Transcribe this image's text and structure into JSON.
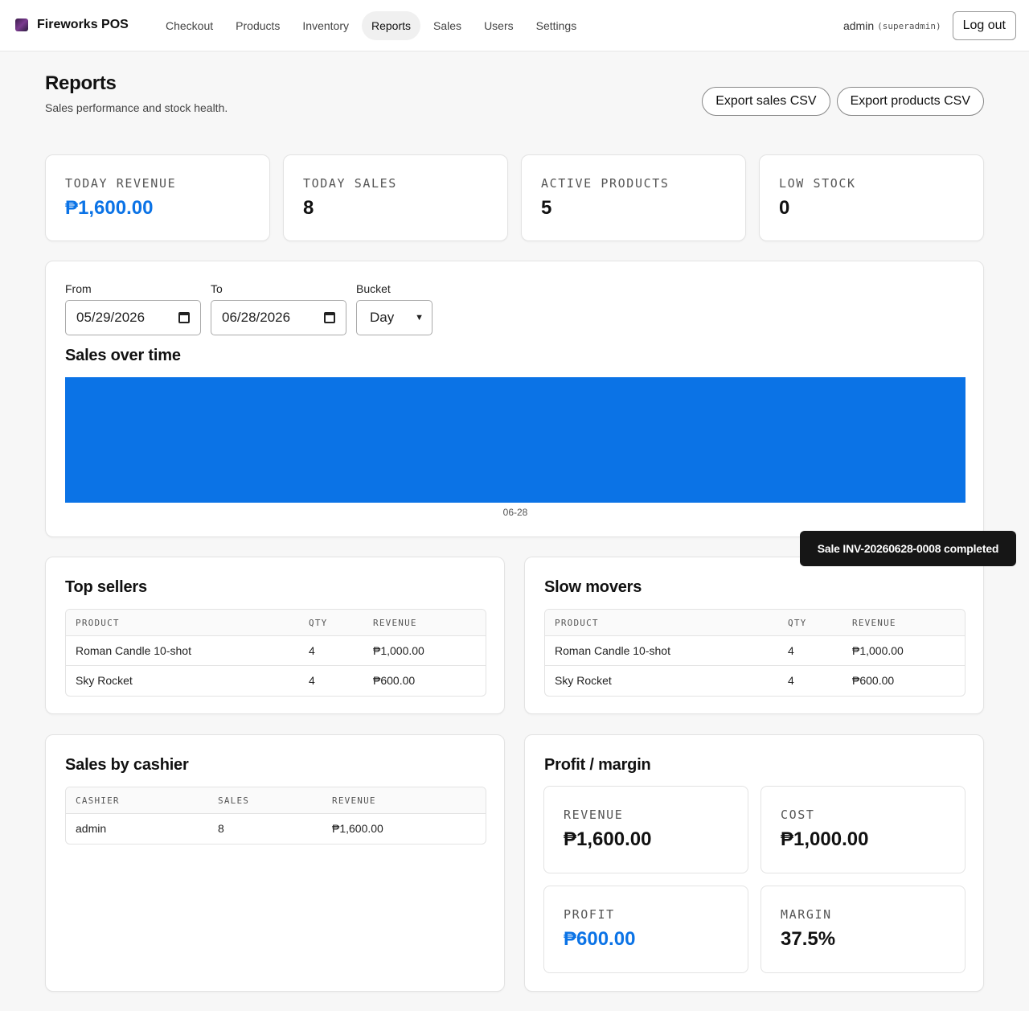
{
  "app": {
    "name": "Fireworks POS"
  },
  "nav": [
    {
      "label": "Checkout",
      "active": false
    },
    {
      "label": "Products",
      "active": false
    },
    {
      "label": "Inventory",
      "active": false
    },
    {
      "label": "Reports",
      "active": true
    },
    {
      "label": "Sales",
      "active": false
    },
    {
      "label": "Users",
      "active": false
    },
    {
      "label": "Settings",
      "active": false
    }
  ],
  "user": {
    "name": "admin",
    "role": "(superadmin)",
    "logout_label": "Log out"
  },
  "header": {
    "title": "Reports",
    "subtitle": "Sales performance and stock health."
  },
  "exports": {
    "sales": "Export sales CSV",
    "products": "Export products CSV"
  },
  "stats": [
    {
      "label": "Today revenue",
      "value": "₱1,600.00",
      "color": "#0b73e6"
    },
    {
      "label": "Today sales",
      "value": "8"
    },
    {
      "label": "Active products",
      "value": "5"
    },
    {
      "label": "Low stock",
      "value": "0"
    }
  ],
  "filters": {
    "from_label": "From",
    "from_value": "05/29/2026",
    "to_label": "To",
    "to_value": "06/28/2026",
    "bucket_label": "Bucket",
    "bucket_value": "Day"
  },
  "chart_title": "Sales over time",
  "chart_data": {
    "type": "bar",
    "categories": [
      "06-28"
    ],
    "values": [
      1600
    ],
    "color": "#0b73e6",
    "grid": false
  },
  "top_sellers": {
    "title": "Top sellers",
    "columns": [
      "PRODUCT",
      "QTY",
      "REVENUE"
    ],
    "rows": [
      [
        "Roman Candle 10-shot",
        "4",
        "₱1,000.00"
      ],
      [
        "Sky Rocket",
        "4",
        "₱600.00"
      ]
    ]
  },
  "slow_movers": {
    "title": "Slow movers",
    "columns": [
      "PRODUCT",
      "QTY",
      "REVENUE"
    ],
    "rows": [
      [
        "Roman Candle 10-shot",
        "4",
        "₱1,000.00"
      ],
      [
        "Sky Rocket",
        "4",
        "₱600.00"
      ]
    ]
  },
  "cashiers": {
    "title": "Sales by cashier",
    "columns": [
      "CASHIER",
      "SALES",
      "REVENUE"
    ],
    "rows": [
      [
        "admin",
        "8",
        "₱1,600.00"
      ]
    ]
  },
  "profit": {
    "title": "Profit / margin",
    "revenue_label": "Revenue",
    "revenue_value": "₱1,600.00",
    "cost_label": "Cost",
    "cost_value": "₱1,000.00",
    "profit_label": "Profit",
    "profit_value": "₱600.00",
    "margin_label": "Margin",
    "margin_value": "37.5%"
  },
  "toast": {
    "message": "Sale INV-20260628-0008 completed"
  }
}
